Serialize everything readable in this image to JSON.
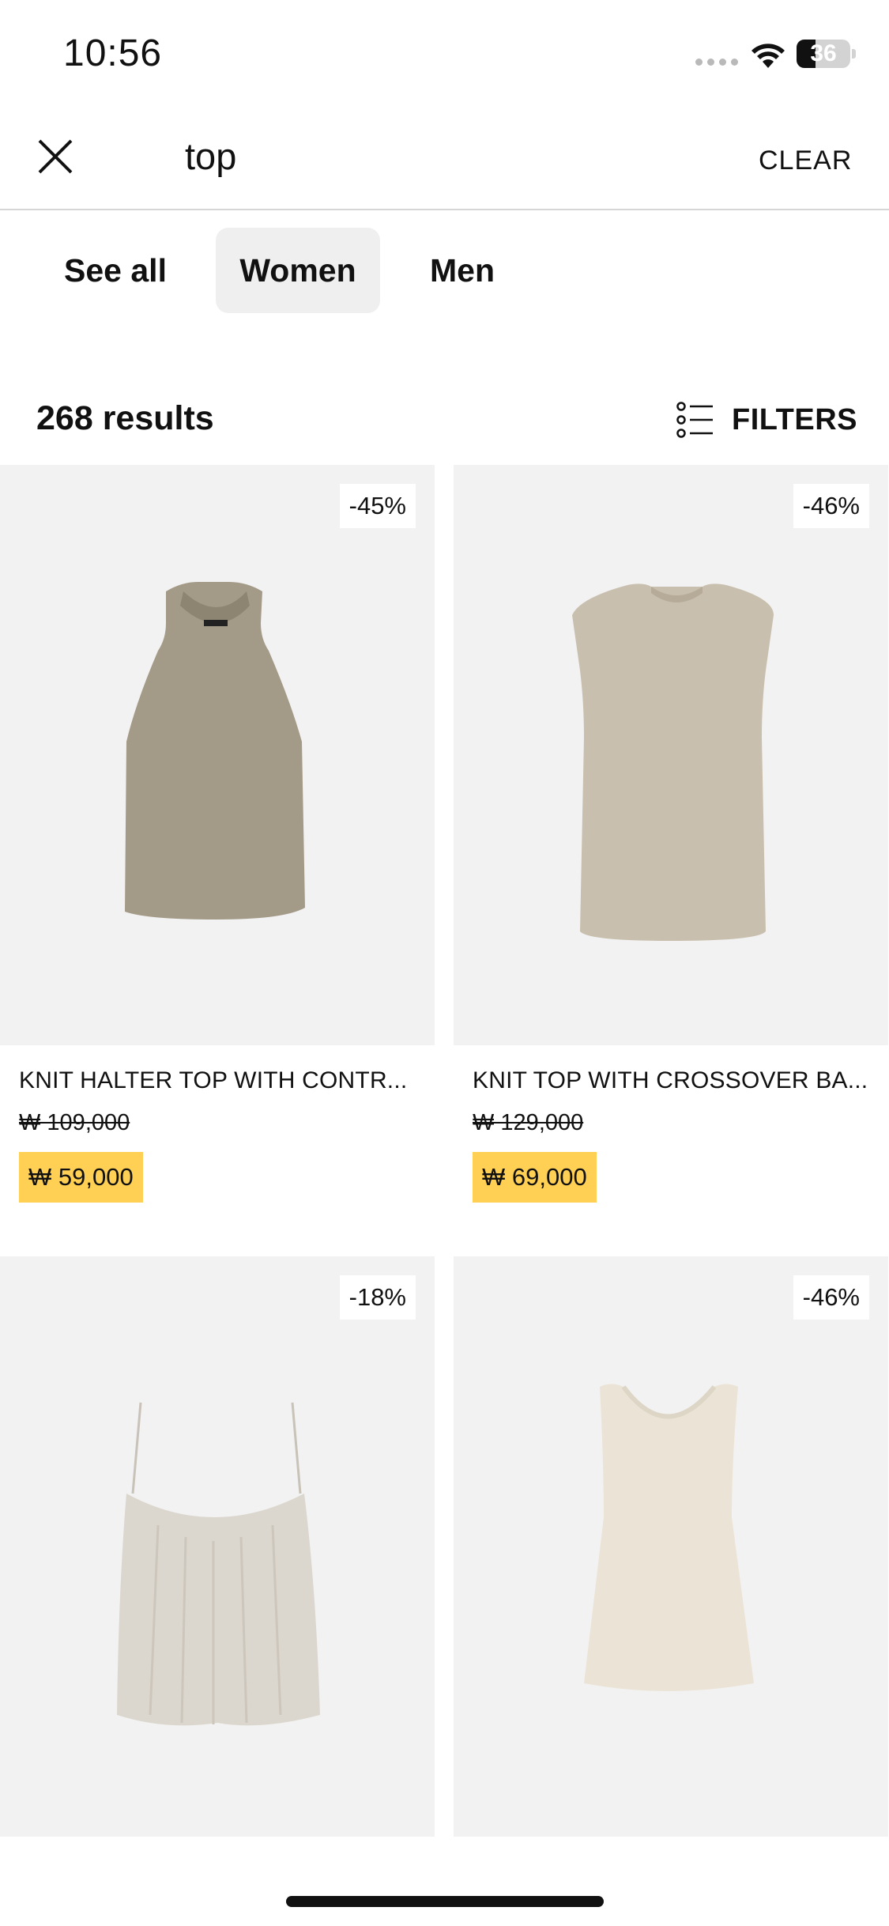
{
  "status_bar": {
    "time": "10:56",
    "battery": "36"
  },
  "search": {
    "query": "top",
    "clear_label": "CLEAR"
  },
  "tabs": [
    {
      "label": "See all",
      "selected": false
    },
    {
      "label": "Women",
      "selected": true
    },
    {
      "label": "Men",
      "selected": false
    }
  ],
  "results": {
    "count_text": "268 results",
    "filters_label": "FILTERS"
  },
  "products": [
    {
      "name": "KNIT HALTER TOP WITH CONTR...",
      "original_price": "₩ 109,000",
      "sale_price": "₩ 59,000",
      "discount": "-45%"
    },
    {
      "name": "KNIT TOP WITH CROSSOVER BA...",
      "original_price": "₩ 129,000",
      "sale_price": "₩ 69,000",
      "discount": "-46%"
    },
    {
      "name": "",
      "original_price": "",
      "sale_price": "",
      "discount": "-18%"
    },
    {
      "name": "",
      "original_price": "",
      "sale_price": "",
      "discount": "-46%"
    }
  ],
  "colors": {
    "sale_highlight": "#ffd054",
    "selected_tab": "#efefef",
    "image_bg": "#f2f2f2"
  }
}
